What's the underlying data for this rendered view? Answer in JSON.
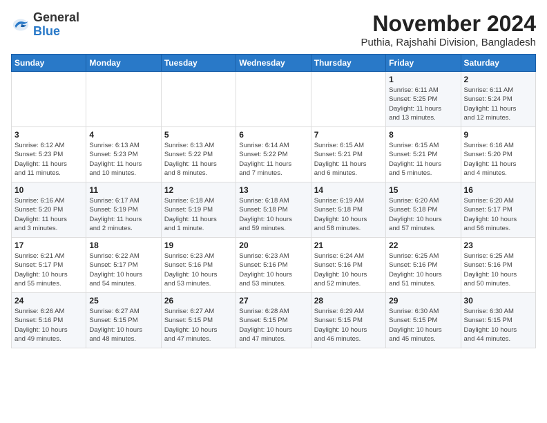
{
  "logo": {
    "general": "General",
    "blue": "Blue"
  },
  "title": "November 2024",
  "subtitle": "Puthia, Rajshahi Division, Bangladesh",
  "days_of_week": [
    "Sunday",
    "Monday",
    "Tuesday",
    "Wednesday",
    "Thursday",
    "Friday",
    "Saturday"
  ],
  "weeks": [
    [
      {
        "day": "",
        "info": ""
      },
      {
        "day": "",
        "info": ""
      },
      {
        "day": "",
        "info": ""
      },
      {
        "day": "",
        "info": ""
      },
      {
        "day": "",
        "info": ""
      },
      {
        "day": "1",
        "info": "Sunrise: 6:11 AM\nSunset: 5:25 PM\nDaylight: 11 hours\nand 13 minutes."
      },
      {
        "day": "2",
        "info": "Sunrise: 6:11 AM\nSunset: 5:24 PM\nDaylight: 11 hours\nand 12 minutes."
      }
    ],
    [
      {
        "day": "3",
        "info": "Sunrise: 6:12 AM\nSunset: 5:23 PM\nDaylight: 11 hours\nand 11 minutes."
      },
      {
        "day": "4",
        "info": "Sunrise: 6:13 AM\nSunset: 5:23 PM\nDaylight: 11 hours\nand 10 minutes."
      },
      {
        "day": "5",
        "info": "Sunrise: 6:13 AM\nSunset: 5:22 PM\nDaylight: 11 hours\nand 8 minutes."
      },
      {
        "day": "6",
        "info": "Sunrise: 6:14 AM\nSunset: 5:22 PM\nDaylight: 11 hours\nand 7 minutes."
      },
      {
        "day": "7",
        "info": "Sunrise: 6:15 AM\nSunset: 5:21 PM\nDaylight: 11 hours\nand 6 minutes."
      },
      {
        "day": "8",
        "info": "Sunrise: 6:15 AM\nSunset: 5:21 PM\nDaylight: 11 hours\nand 5 minutes."
      },
      {
        "day": "9",
        "info": "Sunrise: 6:16 AM\nSunset: 5:20 PM\nDaylight: 11 hours\nand 4 minutes."
      }
    ],
    [
      {
        "day": "10",
        "info": "Sunrise: 6:16 AM\nSunset: 5:20 PM\nDaylight: 11 hours\nand 3 minutes."
      },
      {
        "day": "11",
        "info": "Sunrise: 6:17 AM\nSunset: 5:19 PM\nDaylight: 11 hours\nand 2 minutes."
      },
      {
        "day": "12",
        "info": "Sunrise: 6:18 AM\nSunset: 5:19 PM\nDaylight: 11 hours\nand 1 minute."
      },
      {
        "day": "13",
        "info": "Sunrise: 6:18 AM\nSunset: 5:18 PM\nDaylight: 10 hours\nand 59 minutes."
      },
      {
        "day": "14",
        "info": "Sunrise: 6:19 AM\nSunset: 5:18 PM\nDaylight: 10 hours\nand 58 minutes."
      },
      {
        "day": "15",
        "info": "Sunrise: 6:20 AM\nSunset: 5:18 PM\nDaylight: 10 hours\nand 57 minutes."
      },
      {
        "day": "16",
        "info": "Sunrise: 6:20 AM\nSunset: 5:17 PM\nDaylight: 10 hours\nand 56 minutes."
      }
    ],
    [
      {
        "day": "17",
        "info": "Sunrise: 6:21 AM\nSunset: 5:17 PM\nDaylight: 10 hours\nand 55 minutes."
      },
      {
        "day": "18",
        "info": "Sunrise: 6:22 AM\nSunset: 5:17 PM\nDaylight: 10 hours\nand 54 minutes."
      },
      {
        "day": "19",
        "info": "Sunrise: 6:23 AM\nSunset: 5:16 PM\nDaylight: 10 hours\nand 53 minutes."
      },
      {
        "day": "20",
        "info": "Sunrise: 6:23 AM\nSunset: 5:16 PM\nDaylight: 10 hours\nand 53 minutes."
      },
      {
        "day": "21",
        "info": "Sunrise: 6:24 AM\nSunset: 5:16 PM\nDaylight: 10 hours\nand 52 minutes."
      },
      {
        "day": "22",
        "info": "Sunrise: 6:25 AM\nSunset: 5:16 PM\nDaylight: 10 hours\nand 51 minutes."
      },
      {
        "day": "23",
        "info": "Sunrise: 6:25 AM\nSunset: 5:16 PM\nDaylight: 10 hours\nand 50 minutes."
      }
    ],
    [
      {
        "day": "24",
        "info": "Sunrise: 6:26 AM\nSunset: 5:16 PM\nDaylight: 10 hours\nand 49 minutes."
      },
      {
        "day": "25",
        "info": "Sunrise: 6:27 AM\nSunset: 5:15 PM\nDaylight: 10 hours\nand 48 minutes."
      },
      {
        "day": "26",
        "info": "Sunrise: 6:27 AM\nSunset: 5:15 PM\nDaylight: 10 hours\nand 47 minutes."
      },
      {
        "day": "27",
        "info": "Sunrise: 6:28 AM\nSunset: 5:15 PM\nDaylight: 10 hours\nand 47 minutes."
      },
      {
        "day": "28",
        "info": "Sunrise: 6:29 AM\nSunset: 5:15 PM\nDaylight: 10 hours\nand 46 minutes."
      },
      {
        "day": "29",
        "info": "Sunrise: 6:30 AM\nSunset: 5:15 PM\nDaylight: 10 hours\nand 45 minutes."
      },
      {
        "day": "30",
        "info": "Sunrise: 6:30 AM\nSunset: 5:15 PM\nDaylight: 10 hours\nand 44 minutes."
      }
    ]
  ]
}
